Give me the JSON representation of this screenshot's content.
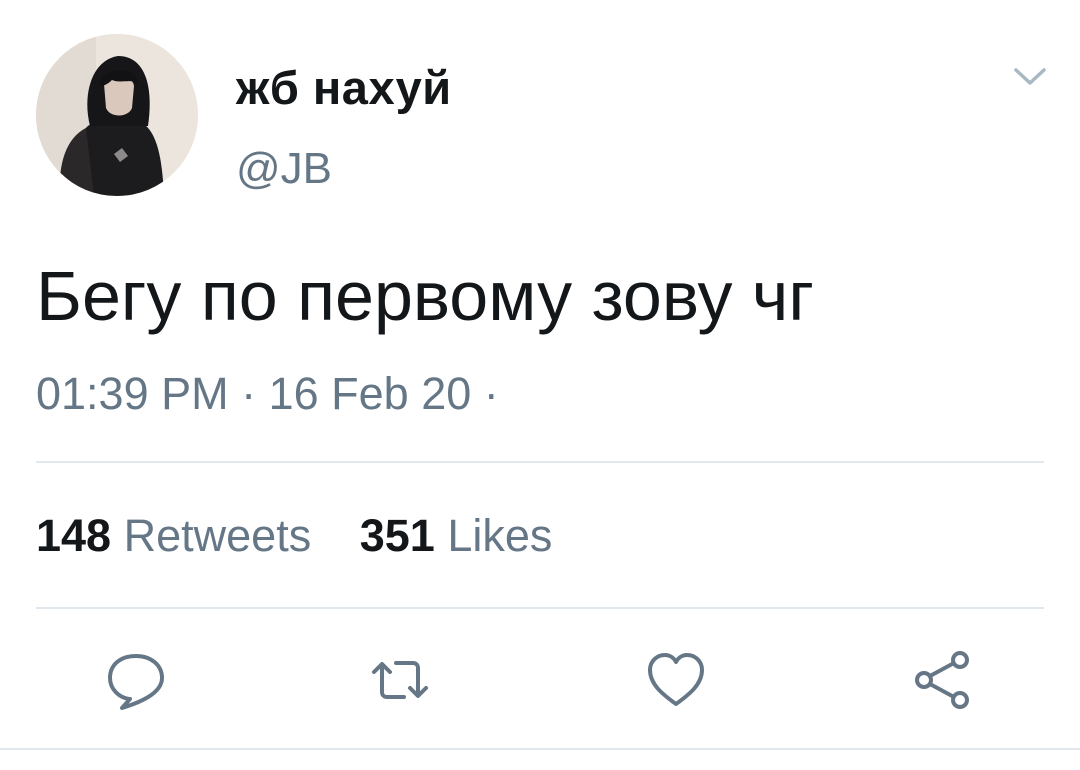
{
  "tweet": {
    "display_name": "жб нахуй",
    "handle": "@JB",
    "text": "Бегу по первому зову чг",
    "timestamp": "01:39 PM · 16 Feb 20 ·",
    "stats": {
      "retweets_count": "148",
      "retweets_label": "Retweets",
      "likes_count": "351",
      "likes_label": "Likes"
    }
  },
  "icons": {
    "menu": "chevron-down-icon",
    "reply": "reply-icon",
    "retweet": "retweet-icon",
    "like": "heart-icon",
    "share": "share-icon"
  },
  "colors": {
    "text": "#14171a",
    "secondary": "#657786",
    "divider": "#e1e8ed",
    "icon": "#657786"
  }
}
